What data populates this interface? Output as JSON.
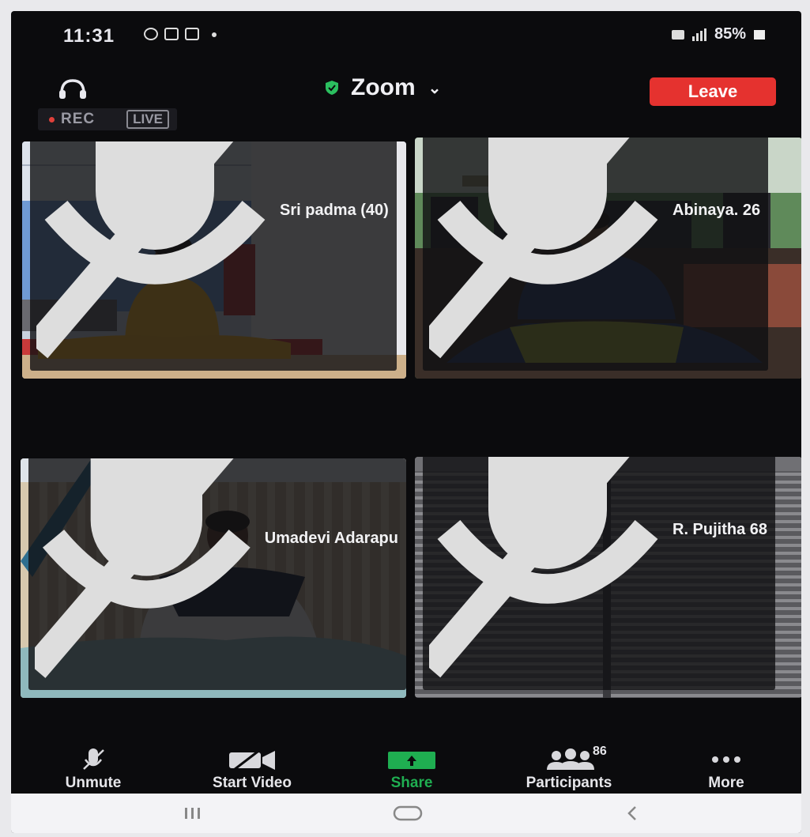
{
  "status_bar": {
    "time": "11:31",
    "battery": "85%"
  },
  "header": {
    "title": "Zoom",
    "leave_label": "Leave"
  },
  "recording": {
    "rec_label": "REC",
    "live_label": "LIVE"
  },
  "participants_tiles": [
    {
      "name": "Sri padma (40)"
    },
    {
      "name": "Abinaya. 26"
    },
    {
      "name": "Umadevi Adarapu"
    },
    {
      "name": "R. Pujitha 68"
    }
  ],
  "toolbar": {
    "unmute_label": "Unmute",
    "start_video_label": "Start Video",
    "share_label": "Share",
    "participants_label": "Participants",
    "participants_count": "86",
    "more_label": "More"
  },
  "colors": {
    "leave_red": "#e5322f",
    "share_green": "#1fae51",
    "shield_green": "#2bbf5f"
  },
  "icons": [
    "headset-icon",
    "shield-icon",
    "chevron-down-icon",
    "mic-muted-icon",
    "video-off-icon",
    "share-arrow-icon",
    "participants-icon",
    "more-dots-icon"
  ]
}
